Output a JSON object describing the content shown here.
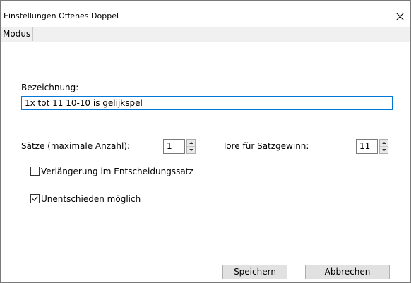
{
  "window": {
    "title": "Einstellungen Offenes Doppel"
  },
  "icons": {
    "close": "close-icon",
    "spin_up": "triangle-up-icon",
    "spin_down": "triangle-down-icon",
    "check": "checkmark-icon"
  },
  "menu": {
    "items": [
      {
        "label": "Modus"
      }
    ]
  },
  "form": {
    "name_label": "Bezeichnung:",
    "name_value": "1x tot 11  10-10 is gelijkspel",
    "sets_label": "Sätze (maximale Anzahl):",
    "sets_value": "1",
    "goals_label": "Tore für Satzgewinn:",
    "goals_value": "11",
    "extension": {
      "label": "Verlängerung im Entscheidungssatz",
      "checked": false
    },
    "draw": {
      "label": "Unentschieden möglich",
      "checked": true
    }
  },
  "buttons": {
    "save": "Speichern",
    "cancel": "Abbrechen"
  },
  "colors": {
    "focus_border": "#0078d7",
    "button_bg": "#e1e1e1",
    "menubar_bg": "#f0f0f0"
  }
}
